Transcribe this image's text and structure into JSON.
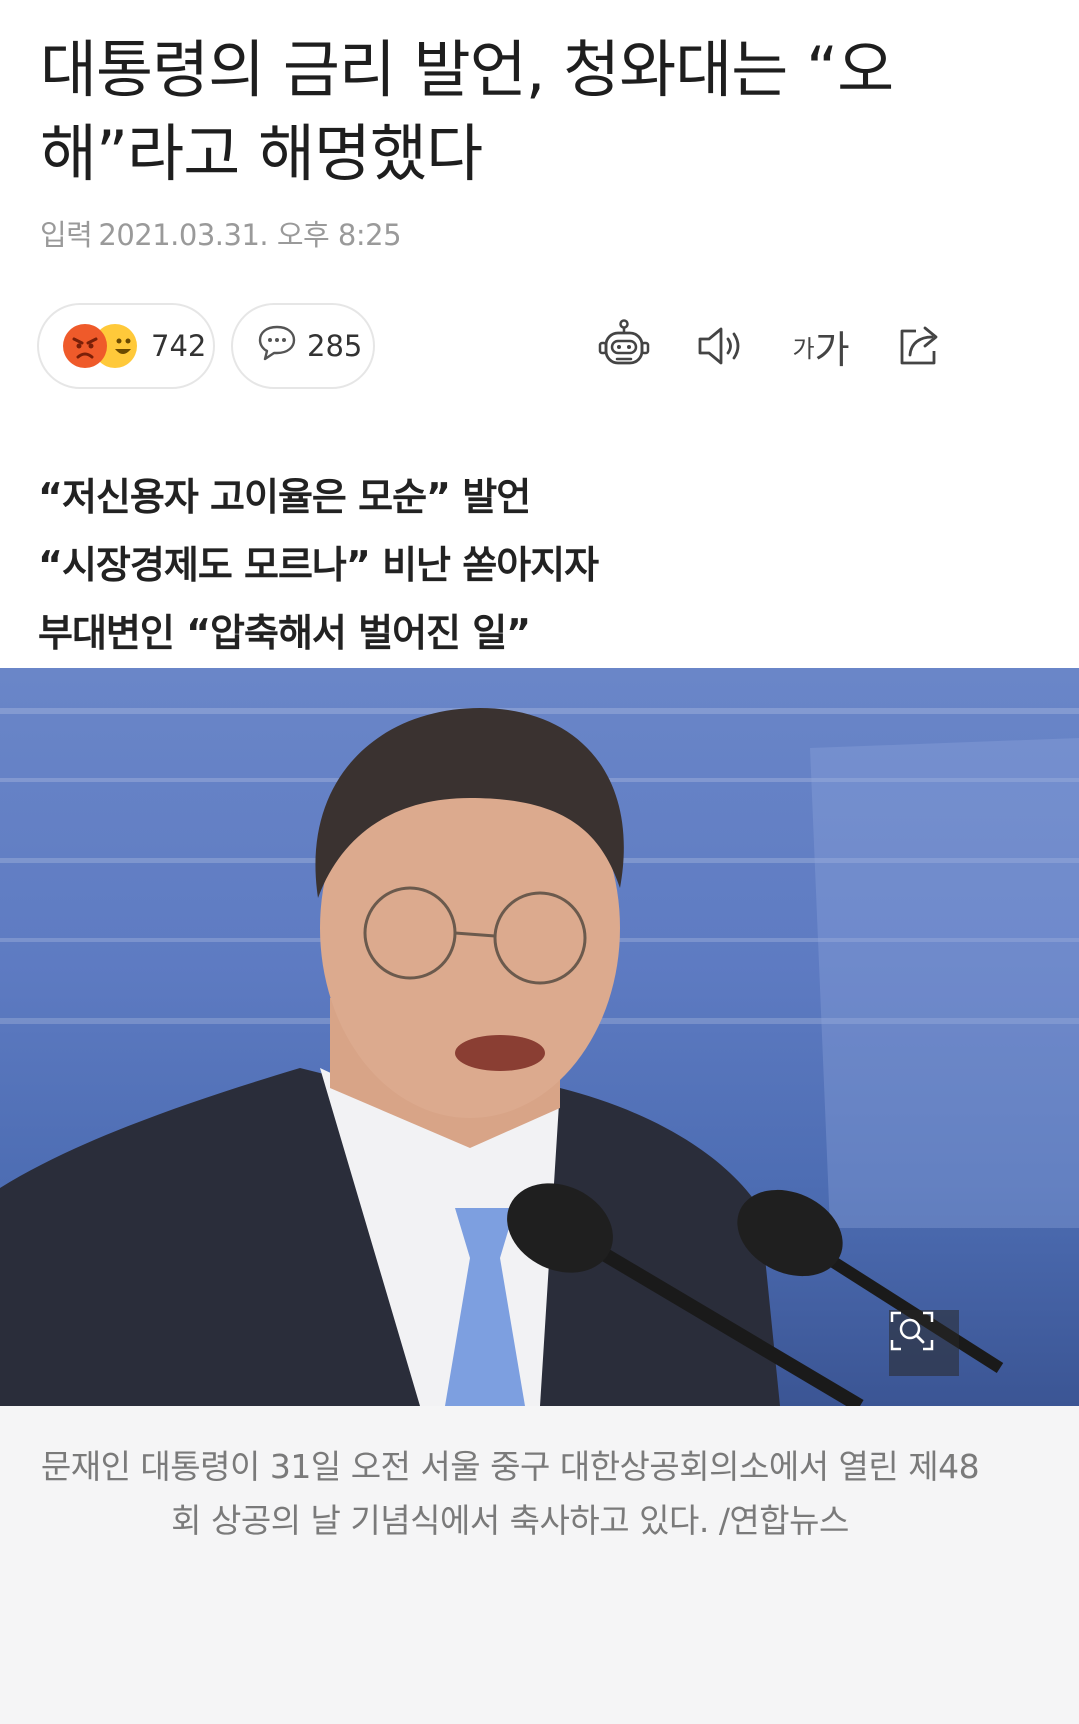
{
  "article": {
    "title": "대통령의 금리 발언, 청와대는 “오해”라고 해명했다",
    "input_label": "입력",
    "date": "2021.03.31. 오후 8:25"
  },
  "reactions": {
    "count": "742",
    "emoji_icons": [
      "angry-face-icon",
      "grinning-face-icon"
    ],
    "colors": {
      "angry": "#ef5a2a",
      "happy": "#ffc93a"
    }
  },
  "comments": {
    "count": "285",
    "icon": "speech-bubble-icon"
  },
  "toolbar": {
    "icons": [
      "robot-summary-icon",
      "speaker-icon",
      "font-size-icon",
      "share-icon"
    ],
    "font_small": "가",
    "font_big": "가"
  },
  "subtitles": [
    "“저신용자 고이율은 모순” 발언",
    "“시장경제도 모르나” 비난 쏟아지자",
    "부대변인 “압축해서 벌어진 일”"
  ],
  "photo": {
    "zoom_icon": "magnifier-zoom-icon"
  },
  "caption": "문재인 대통령이 31일 오전 서울 중구 대한상공회의소에서 열린 제48회 상공의 날 기념식에서 축사하고 있다. /연합뉴스"
}
